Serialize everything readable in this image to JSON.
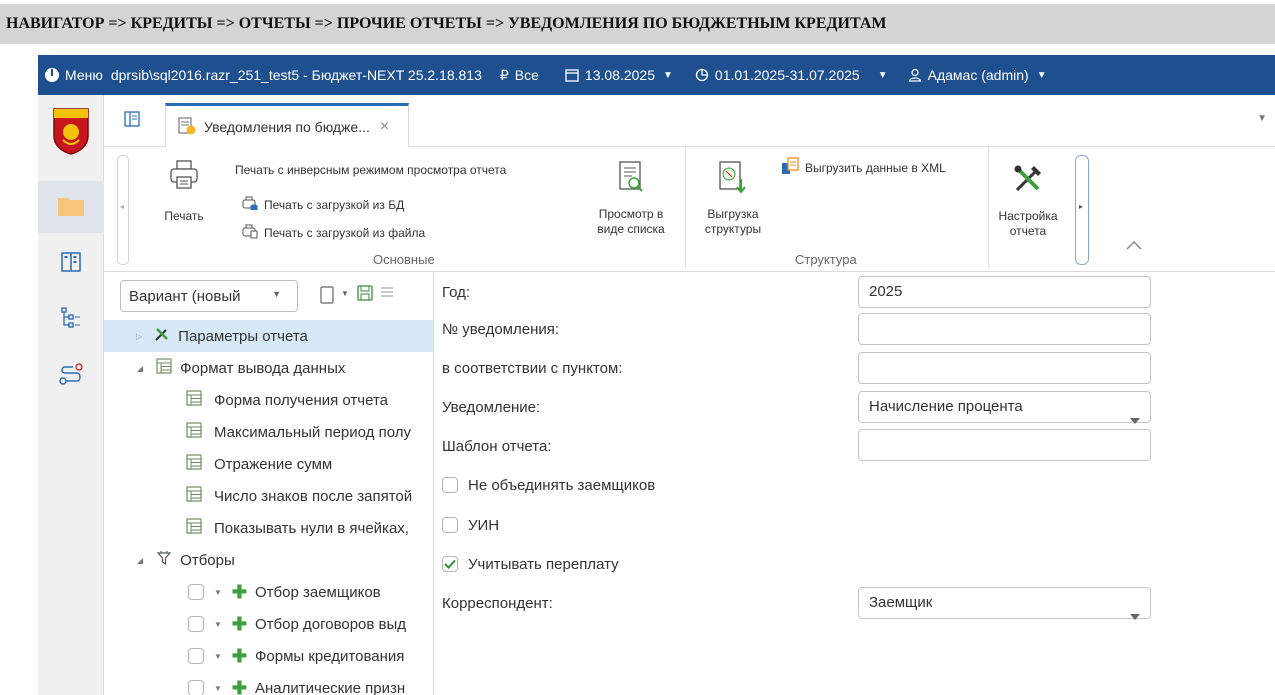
{
  "breadcrumb": "НАВИГАТОР => КРЕДИТЫ => ОТЧЕТЫ => ПРОЧИЕ ОТЧЕТЫ => УВЕДОМЛЕНИЯ ПО БЮДЖЕТНЫМ КРЕДИТАМ",
  "appbar": {
    "menu_label": "Меню",
    "connection": "dprsib\\sql2016.razr_251_test5 - Бюджет-NEXT 25.2.18.813",
    "budget_filter": "Все",
    "date": "13.08.2025",
    "period": "01.01.2025-31.07.2025",
    "user": "Адамас (admin)"
  },
  "tab": {
    "label": "Уведомления по бюдже..."
  },
  "ribbon": {
    "print": "Печать",
    "print_inverse": "Печать с инверсным режимом просмотра отчета",
    "print_db": "Печать с загрузкой из БД",
    "print_file": "Печать с загрузкой из файла",
    "view_list": "Просмотр в виде списка",
    "export_structure": "Выгрузка структуры",
    "export_xml": "Выгрузить данные в XML",
    "report_settings": "Настройка отчета",
    "group_main": "Основные",
    "group_structure": "Структура"
  },
  "tree": {
    "variant": "Вариант (новый",
    "items": [
      "Параметры отчета",
      "Формат вывода данных",
      "Форма получения отчета",
      "Максимальный период полу",
      "Отражение сумм",
      "Число знаков после запятой",
      "Показывать нули в ячейках,",
      "Отборы",
      "Отбор заемщиков",
      "Отбор договоров выд",
      "Формы кредитования",
      "Аналитические призн"
    ]
  },
  "form": {
    "year_label": "Год:",
    "year_value": "2025",
    "notice_no_label": "№ уведомления:",
    "notice_no_value": "",
    "clause_label": "в соответствии с пунктом:",
    "clause_value": "",
    "notice_label": "Уведомление:",
    "notice_value": "Начисление процента",
    "template_label": "Шаблон отчета:",
    "template_value": "",
    "no_merge_label": "Не объединять заемщиков",
    "uin_label": "УИН",
    "overpay_label": "Учитывать переплату",
    "correspondent_label": "Корреспондент:",
    "correspondent_value": "Заемщик"
  },
  "colors": {
    "appbar": "#1e4f8f",
    "tab_accent": "#2a6ab6",
    "selection": "#d7e8f7",
    "green": "#3aa13a"
  }
}
